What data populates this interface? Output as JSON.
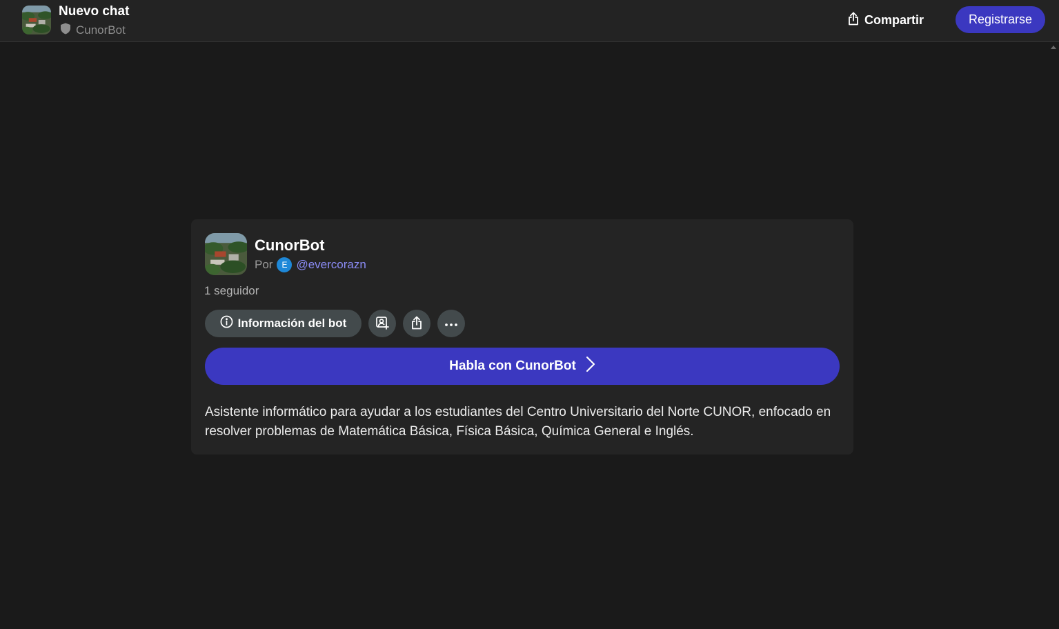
{
  "header": {
    "title": "Nuevo chat",
    "bot_name": "CunorBot",
    "share_label": "Compartir",
    "register_label": "Registrarse"
  },
  "card": {
    "bot_name": "CunorBot",
    "by_label": "Por",
    "creator_initial": "E",
    "creator_handle": "@evercorazn",
    "followers": "1 seguidor",
    "info_label": "Información del bot",
    "talk_label": "Habla con CunorBot",
    "description": "Asistente informático para ayudar a los estudiantes del Centro Universitario del Norte CUNOR, enfocado en resolver problemas de Matemática Básica, Física Básica, Química General e Inglés."
  },
  "icons": {
    "avatar": "aerial-campus-photo",
    "private": "shield-icon",
    "share": "share-icon",
    "info": "info-icon",
    "user_add": "user-add-icon",
    "more": "more-horizontal-icon",
    "chevron": "chevron-right-icon"
  },
  "colors": {
    "background": "#1a1a1a",
    "header": "#232323",
    "card": "#242424",
    "accent": "#3b38c0",
    "link": "#8b8cf6",
    "button_gray": "#434a4c"
  }
}
